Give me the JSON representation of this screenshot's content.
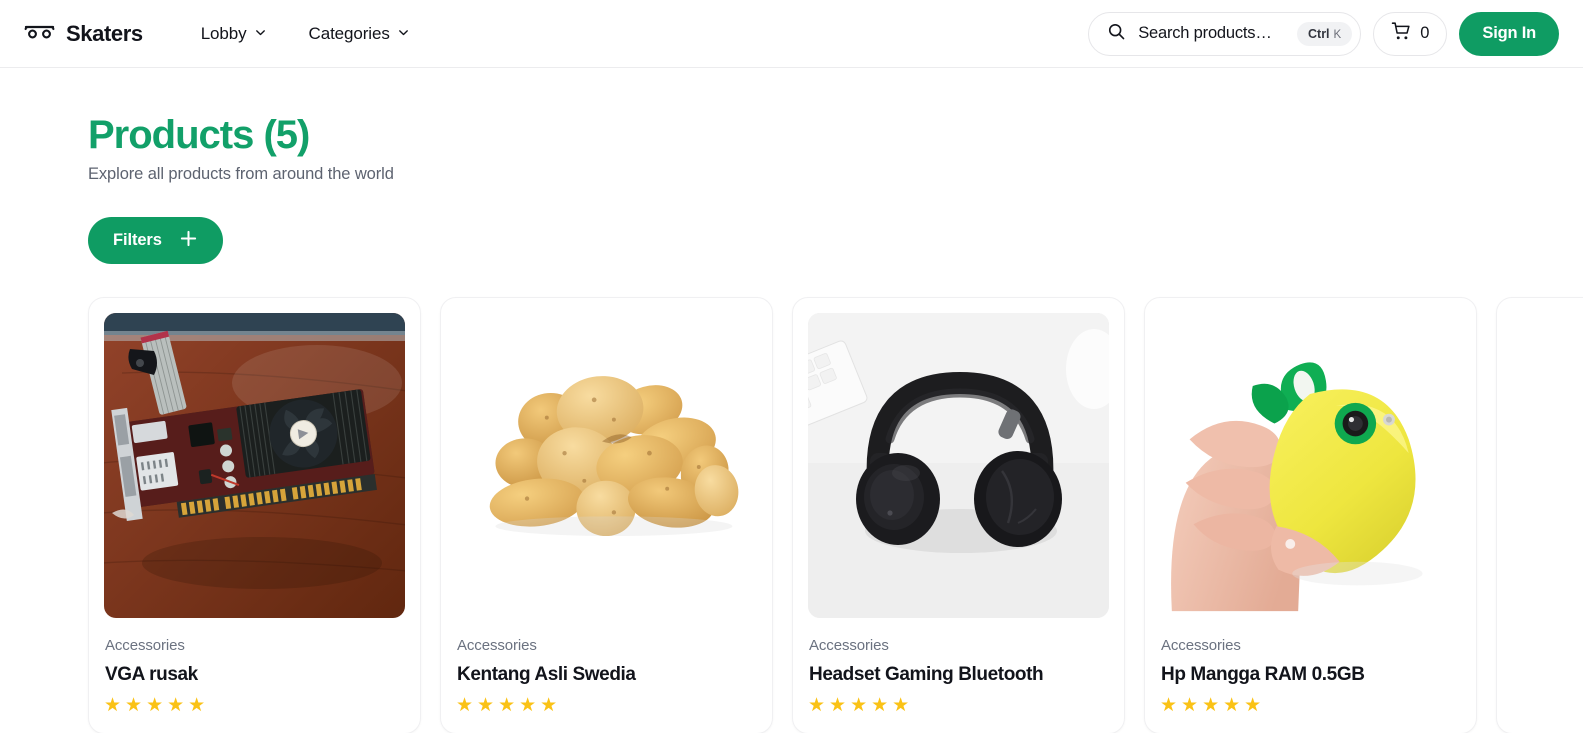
{
  "header": {
    "brand": {
      "name": "Skaters",
      "icon": "skateboard-icon"
    },
    "nav": [
      {
        "label": "Lobby",
        "icon": "chevron-down-icon"
      },
      {
        "label": "Categories",
        "icon": "chevron-down-icon"
      }
    ],
    "search": {
      "placeholder": "Search products…",
      "value": "",
      "icon": "search-icon",
      "shortcut_modifier": "Ctrl",
      "shortcut_key": "K"
    },
    "cart": {
      "icon": "shopping-cart-icon",
      "count": "0"
    },
    "sign_in_label": "Sign In"
  },
  "main": {
    "title": "Products (5)",
    "subtitle": "Explore all products from around the world",
    "filters_label": "Filters",
    "filters_icon": "plus-icon",
    "products": [
      {
        "category": "Accessories",
        "name": "VGA rusak",
        "rating": 5,
        "stars": "★★★★★",
        "image": "graphics-card-on-wooden-desk"
      },
      {
        "category": "Accessories",
        "name": "Kentang Asli Swedia",
        "rating": 5,
        "stars": "★★★★★",
        "image": "pile-of-potatoes-on-white"
      },
      {
        "category": "Accessories",
        "name": "Headset Gaming Bluetooth",
        "rating": 5,
        "stars": "★★★★★",
        "image": "black-over-ear-headphones-on-desk"
      },
      {
        "category": "Accessories",
        "name": "Hp Mangga RAM 0.5GB",
        "rating": 5,
        "stars": "★★★★★",
        "image": "yellow-mango-shaped-phone-in-hand"
      }
    ]
  },
  "colors": {
    "brand_green": "#0f9c63",
    "title_green": "#12a069",
    "star_gold": "#fac216",
    "text_dark": "#12141b",
    "text_muted": "#6b7280"
  }
}
